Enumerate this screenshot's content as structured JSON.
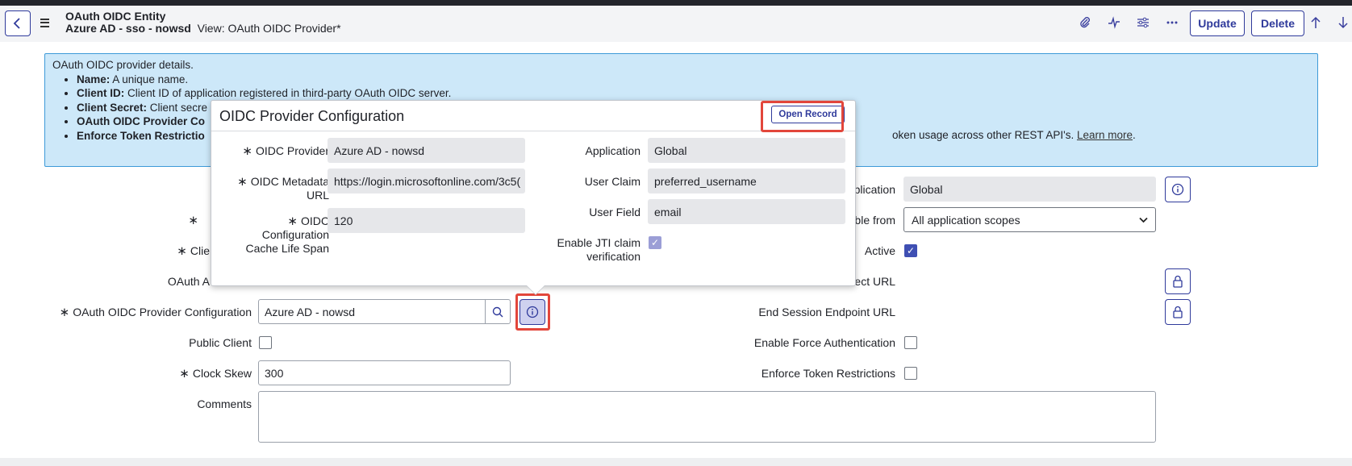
{
  "header": {
    "table_name": "OAuth OIDC Entity",
    "record_name": "Azure AD - sso - nowsd",
    "view_label": "View: OAuth OIDC Provider*",
    "update_label": "Update",
    "delete_label": "Delete"
  },
  "help": {
    "intro": "OAuth OIDC provider details.",
    "items": [
      {
        "term": "Name:",
        "desc": " A unique name."
      },
      {
        "term": "Client ID:",
        "desc": " Client ID of application registered in third-party OAuth OIDC server."
      },
      {
        "term": "Client Secret:",
        "desc": " Client secre"
      },
      {
        "term": "OAuth OIDC Provider Co",
        "desc": ""
      },
      {
        "term": "Enforce Token Restrictio",
        "desc": ""
      }
    ],
    "tail_text": "oken usage across other REST API's. ",
    "learn_more": "Learn more",
    "period": "."
  },
  "form": {
    "application_label": "plication",
    "application_value": "Global",
    "accessible_label": "ble from",
    "accessible_value": "All application scopes",
    "active_label": "Active",
    "redirect_label": "ect URL",
    "oauth_a_label": "OAuth A",
    "clie_label": "Clie",
    "provider_config_label": "OAuth OIDC Provider Configuration",
    "provider_config_value": "Azure AD - nowsd",
    "end_session_label": "End Session Endpoint URL",
    "public_client_label": "Public Client",
    "force_auth_label": "Enable Force Authentication",
    "clock_skew_label": "Clock Skew",
    "clock_skew_value": "300",
    "enforce_token_label": "Enforce Token Restrictions",
    "comments_label": "Comments",
    "required_mark": "∗"
  },
  "popup": {
    "title": "OIDC Provider Configuration",
    "open_record_label": "Open Record",
    "oidc_provider_label": "OIDC Provider",
    "oidc_provider_value": "Azure AD - nowsd",
    "metadata_label_1": "OIDC Metadata",
    "metadata_label_2": "URL",
    "metadata_value": "https://login.microsoftonline.com/3c5(",
    "cache_label_1": "OIDC",
    "cache_label_2": "Configuration",
    "cache_label_3": "Cache Life Span",
    "cache_value": "120",
    "application_label": "Application",
    "application_value": "Global",
    "user_claim_label": "User Claim",
    "user_claim_value": "preferred_username",
    "user_field_label": "User Field",
    "user_field_value": "email",
    "jti_label_1": "Enable JTI claim",
    "jti_label_2": "verification"
  },
  "icons": {
    "back": "chevron-left-icon",
    "menu": "hamburger-menu-icon",
    "attachment": "paperclip-icon",
    "activity": "activity-pulse-icon",
    "settings": "sliders-icon",
    "more": "more-options-icon",
    "up": "arrow-up-icon",
    "down": "arrow-down-icon",
    "info": "info-icon",
    "lock": "lock-icon",
    "search": "search-icon"
  },
  "colors": {
    "accent": "#2f3a9b",
    "help_bg": "#cde8f9",
    "highlight": "#e2463b",
    "checkbox_checked": "#3f4fb3"
  }
}
